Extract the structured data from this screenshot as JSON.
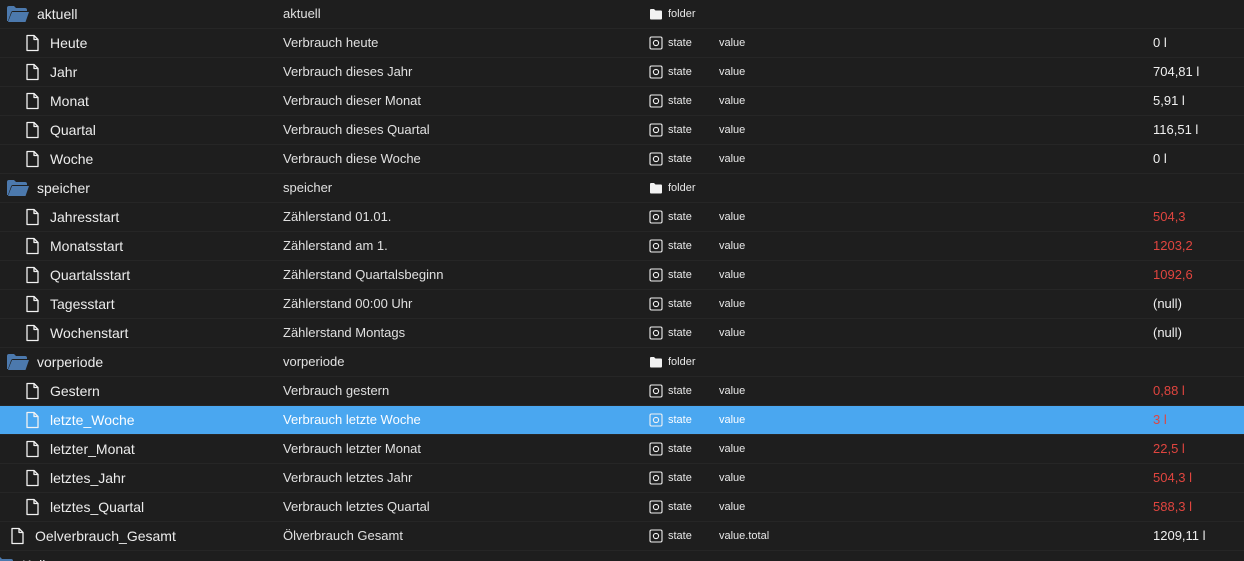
{
  "icons": {
    "folder_open": "folder-open-icon",
    "file": "file-icon",
    "folder_small": "folder-icon",
    "state": "state-icon"
  },
  "colors": {
    "background": "#1e1e1e",
    "selected_row": "#4aa7f0",
    "folder_icon": "#4c79ad",
    "value_red": "#e0453f"
  },
  "rows": [
    {
      "kind": "folder",
      "level": 0,
      "name": "aktuell",
      "desc": "aktuell",
      "type": "folder",
      "role": "",
      "value": "",
      "red": false,
      "selected": false
    },
    {
      "kind": "state",
      "level": 1,
      "name": "Heute",
      "desc": "Verbrauch heute",
      "type": "state",
      "role": "value",
      "value": "0 l",
      "red": false,
      "selected": false
    },
    {
      "kind": "state",
      "level": 1,
      "name": "Jahr",
      "desc": "Verbrauch dieses Jahr",
      "type": "state",
      "role": "value",
      "value": "704,81 l",
      "red": false,
      "selected": false
    },
    {
      "kind": "state",
      "level": 1,
      "name": "Monat",
      "desc": "Verbrauch dieser Monat",
      "type": "state",
      "role": "value",
      "value": "5,91 l",
      "red": false,
      "selected": false
    },
    {
      "kind": "state",
      "level": 1,
      "name": "Quartal",
      "desc": "Verbrauch dieses Quartal",
      "type": "state",
      "role": "value",
      "value": "116,51 l",
      "red": false,
      "selected": false
    },
    {
      "kind": "state",
      "level": 1,
      "name": "Woche",
      "desc": "Verbrauch diese Woche",
      "type": "state",
      "role": "value",
      "value": "0 l",
      "red": false,
      "selected": false
    },
    {
      "kind": "folder",
      "level": 0,
      "name": "speicher",
      "desc": "speicher",
      "type": "folder",
      "role": "",
      "value": "",
      "red": false,
      "selected": false
    },
    {
      "kind": "state",
      "level": 1,
      "name": "Jahresstart",
      "desc": "Zählerstand 01.01.",
      "type": "state",
      "role": "value",
      "value": "504,3",
      "red": true,
      "selected": false
    },
    {
      "kind": "state",
      "level": 1,
      "name": "Monatsstart",
      "desc": "Zählerstand am 1.",
      "type": "state",
      "role": "value",
      "value": "1203,2",
      "red": true,
      "selected": false
    },
    {
      "kind": "state",
      "level": 1,
      "name": "Quartalsstart",
      "desc": "Zählerstand Quartalsbeginn",
      "type": "state",
      "role": "value",
      "value": "1092,6",
      "red": true,
      "selected": false
    },
    {
      "kind": "state",
      "level": 1,
      "name": "Tagesstart",
      "desc": "Zählerstand 00:00 Uhr",
      "type": "state",
      "role": "value",
      "value": "(null)",
      "red": false,
      "selected": false
    },
    {
      "kind": "state",
      "level": 1,
      "name": "Wochenstart",
      "desc": "Zählerstand Montags",
      "type": "state",
      "role": "value",
      "value": "(null)",
      "red": false,
      "selected": false
    },
    {
      "kind": "folder",
      "level": 0,
      "name": "vorperiode",
      "desc": "vorperiode",
      "type": "folder",
      "role": "",
      "value": "",
      "red": false,
      "selected": false
    },
    {
      "kind": "state",
      "level": 1,
      "name": "Gestern",
      "desc": "Verbrauch gestern",
      "type": "state",
      "role": "value",
      "value": "0,88 l",
      "red": true,
      "selected": false
    },
    {
      "kind": "state",
      "level": 1,
      "name": "letzte_Woche",
      "desc": "Verbrauch letzte Woche",
      "type": "state",
      "role": "value",
      "value": "3 l",
      "red": true,
      "selected": true
    },
    {
      "kind": "state",
      "level": 1,
      "name": "letzter_Monat",
      "desc": "Verbrauch letzter Monat",
      "type": "state",
      "role": "value",
      "value": "22,5 l",
      "red": true,
      "selected": false
    },
    {
      "kind": "state",
      "level": 1,
      "name": "letztes_Jahr",
      "desc": "Verbrauch letztes Jahr",
      "type": "state",
      "role": "value",
      "value": "504,3 l",
      "red": true,
      "selected": false
    },
    {
      "kind": "state",
      "level": 1,
      "name": "letztes_Quartal",
      "desc": "Verbrauch letztes Quartal",
      "type": "state",
      "role": "value",
      "value": "588,3 l",
      "red": true,
      "selected": false
    },
    {
      "kind": "state",
      "level": 0,
      "name": "Oelverbrauch_Gesamt",
      "desc": "Ölverbrauch Gesamt",
      "type": "state",
      "role": "value.total",
      "value": "1209,11 l",
      "red": false,
      "selected": false
    },
    {
      "kind": "folder",
      "level": -1,
      "name": "Kell",
      "desc": "",
      "type": "",
      "role": "",
      "value": "",
      "red": false,
      "selected": false
    }
  ]
}
